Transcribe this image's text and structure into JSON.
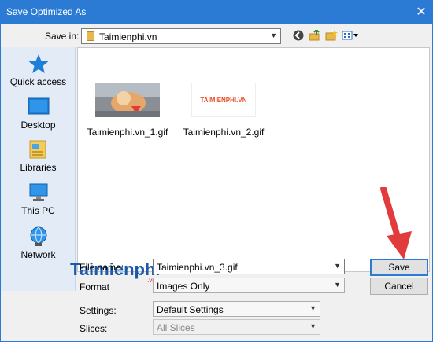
{
  "window": {
    "title": "Save Optimized As",
    "close_glyph": "✕"
  },
  "header": {
    "save_in_label": "Save in:",
    "save_in_value": "Taimienphi.vn"
  },
  "places": [
    {
      "label": "Quick access",
      "icon": "star-icon"
    },
    {
      "label": "Desktop",
      "icon": "desktop-icon"
    },
    {
      "label": "Libraries",
      "icon": "libraries-icon"
    },
    {
      "label": "This PC",
      "icon": "computer-icon"
    },
    {
      "label": "Network",
      "icon": "network-icon"
    }
  ],
  "files": [
    {
      "name": "Taimienphi.vn_1.gif",
      "thumb": "cat photo"
    },
    {
      "name": "Taimienphi.vn_2.gif",
      "thumb_text": "TAIMIENPHI.VN"
    }
  ],
  "form": {
    "filename_label": "File name:",
    "filename_value": "Taimienphi.vn_3.gif",
    "format_label": "Format",
    "format_value": "Images Only",
    "settings_label": "Settings:",
    "settings_value": "Default Settings",
    "slices_label": "Slices:",
    "slices_value": "All Slices"
  },
  "buttons": {
    "save": "Save",
    "cancel": "Cancel"
  },
  "watermark": {
    "text": "Taimienphi",
    "sub": ".vn"
  },
  "colors": {
    "titlebar": "#2b7ad3",
    "places_bg": "#e3ebf6",
    "arrow": "#e23b3b"
  }
}
